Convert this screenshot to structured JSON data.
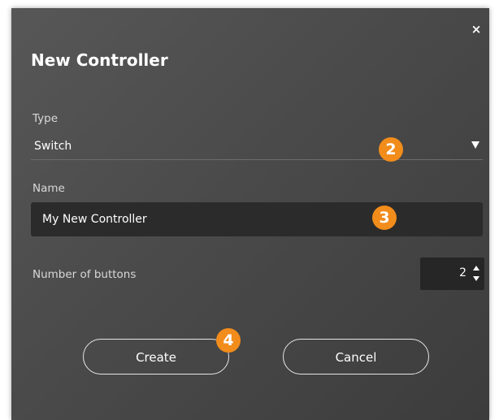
{
  "dialog": {
    "title": "New Controller",
    "close_label": "×",
    "type": {
      "label": "Type",
      "value": "Switch"
    },
    "name": {
      "label": "Name",
      "value": "My New Controller"
    },
    "buttons_count": {
      "label": "Number of buttons",
      "value": "2"
    },
    "actions": {
      "create": "Create",
      "cancel": "Cancel"
    }
  },
  "callouts": [
    "2",
    "3",
    "4"
  ],
  "colors": {
    "dialog_bg": "#4a4a4a",
    "input_bg": "#2b2b2b",
    "callout": "#f28c1b",
    "text": "#ffffff"
  },
  "icons": {
    "close": "close-icon",
    "dropdown": "chevron-down-icon",
    "stepper_up": "chevron-up-icon",
    "stepper_down": "chevron-down-icon"
  }
}
